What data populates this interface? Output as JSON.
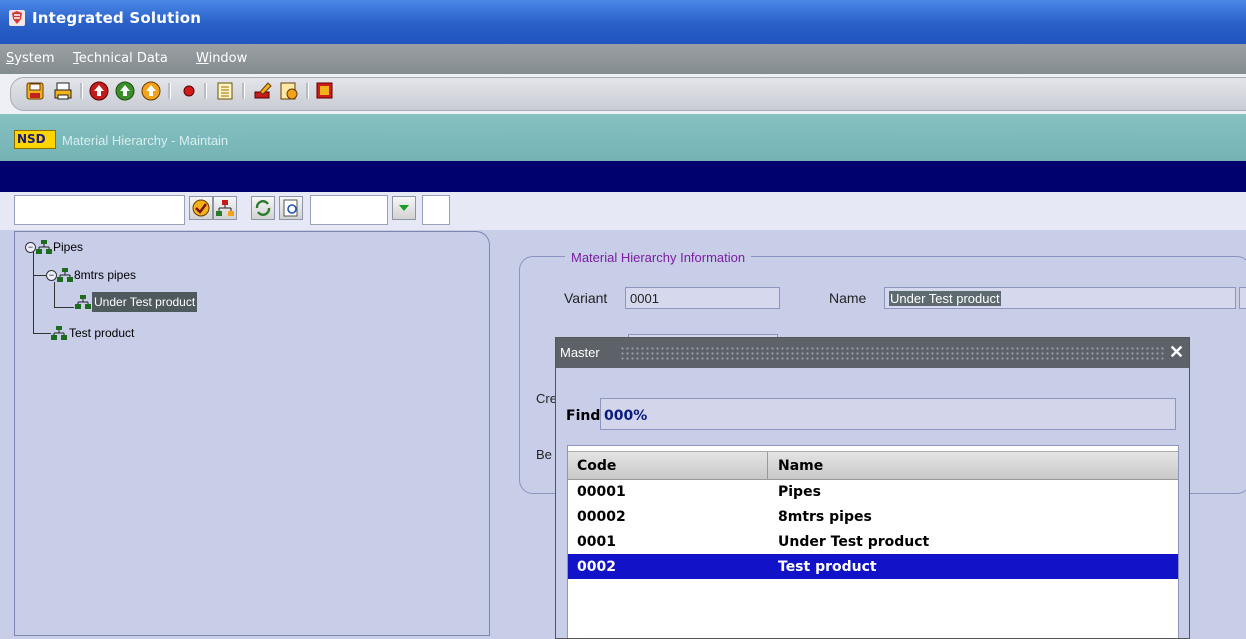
{
  "window": {
    "title": "Integrated Solution"
  },
  "menu": {
    "items": [
      "System",
      "Technical Data",
      "Window"
    ]
  },
  "toolbar": {
    "buttons": [
      "save-icon",
      "print-icon",
      "nav-up-icon",
      "nav-prev-icon",
      "nav-next-icon",
      "record-icon",
      "list-icon",
      "edit-icon",
      "document-icon",
      "exit-icon"
    ]
  },
  "module": {
    "logo": "NSD",
    "title": "Material  Hierarchy - Maintain"
  },
  "tree": {
    "nodes": [
      "Pipes",
      "8mtrs pipes",
      "Under Test product",
      "Test product"
    ]
  },
  "info": {
    "section_title": "Material Hierarchy Information",
    "variant_label": "Variant",
    "variant_value": "0001",
    "name_label": "Name",
    "name_value": "Under Test product",
    "created_label_partial": "Cre",
    "begin_label_partial": "Be"
  },
  "dialog": {
    "title": "Master",
    "find_label": "Find",
    "find_value": "000%",
    "columns": [
      "Code",
      "Name"
    ],
    "rows": [
      {
        "code": "00001",
        "name": "Pipes"
      },
      {
        "code": "00002",
        "name": "8mtrs pipes"
      },
      {
        "code": "0001",
        "name": "Under Test product"
      },
      {
        "code": "0002",
        "name": "Test product"
      }
    ],
    "selected_index": 3
  },
  "colors": {
    "titlebar": "#2b62c9",
    "module_header": "#74b3b5",
    "navy_band": "#00006e",
    "selection": "#1212c8",
    "section_title": "#7a1fa0"
  }
}
